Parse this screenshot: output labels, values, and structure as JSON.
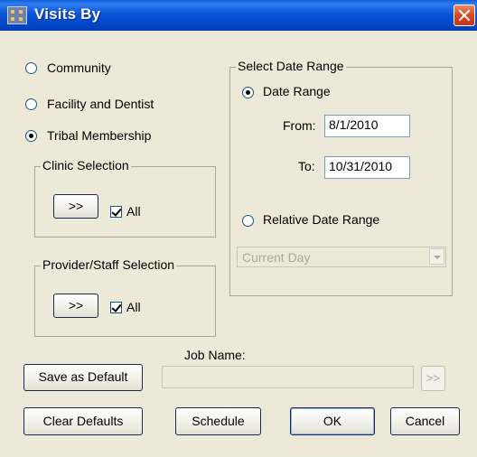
{
  "window": {
    "title": "Visits By"
  },
  "report_by": {
    "options": [
      {
        "label": "Community",
        "selected": false
      },
      {
        "label": "Facility and Dentist",
        "selected": false
      },
      {
        "label": "Tribal Membership",
        "selected": true
      }
    ]
  },
  "clinic_selection": {
    "legend": "Clinic Selection",
    "select_label": ">>",
    "all_label": "All",
    "all_checked": true
  },
  "provider_selection": {
    "legend": "Provider/Staff Selection",
    "select_label": ">>",
    "all_label": "All",
    "all_checked": true
  },
  "date_range": {
    "legend": "Select Date Range",
    "date_range_label": "Date Range",
    "date_range_selected": true,
    "from_label": "From:",
    "from_value": "8/1/2010",
    "to_label": "To:",
    "to_value": "10/31/2010",
    "relative_label": "Relative Date Range",
    "relative_selected": false,
    "relative_value": "Current Day"
  },
  "job": {
    "label": "Job Name:",
    "value": "",
    "browse_label": ">>"
  },
  "buttons": {
    "save_default": "Save as Default",
    "clear_defaults": "Clear Defaults",
    "schedule": "Schedule",
    "ok": "OK",
    "cancel": "Cancel"
  }
}
